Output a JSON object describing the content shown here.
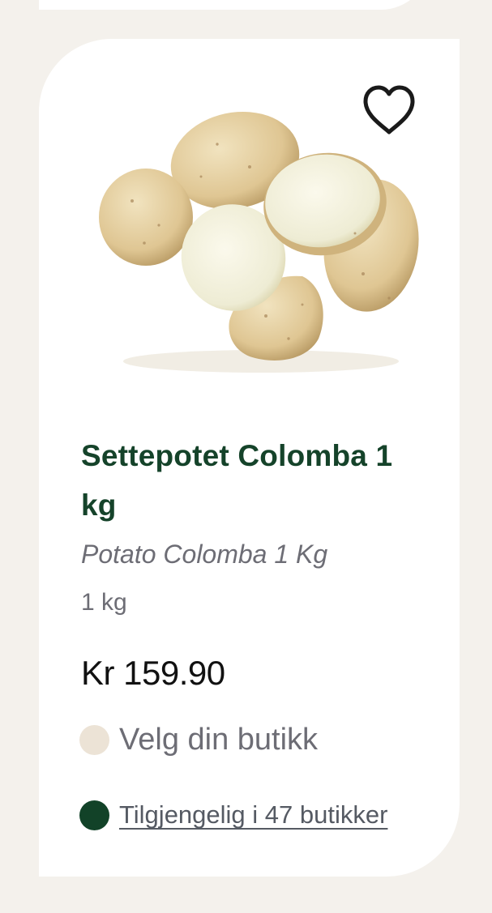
{
  "product": {
    "title": "Settepotet Colomba 1 kg",
    "subtitle": "Potato Colomba 1 Kg",
    "weight": "1 kg",
    "price": "Kr 159.90",
    "image_icon": "potatoes-image"
  },
  "favorite": {
    "icon": "heart-outline-icon"
  },
  "store": {
    "select_label": "Velg din butikk",
    "dot_color": "#ece3d6"
  },
  "availability": {
    "label": "Tilgjengelig i 47 butikker",
    "dot_color": "#124228"
  },
  "colors": {
    "title": "#15432a",
    "background": "#f4f1ec",
    "card": "#ffffff"
  }
}
